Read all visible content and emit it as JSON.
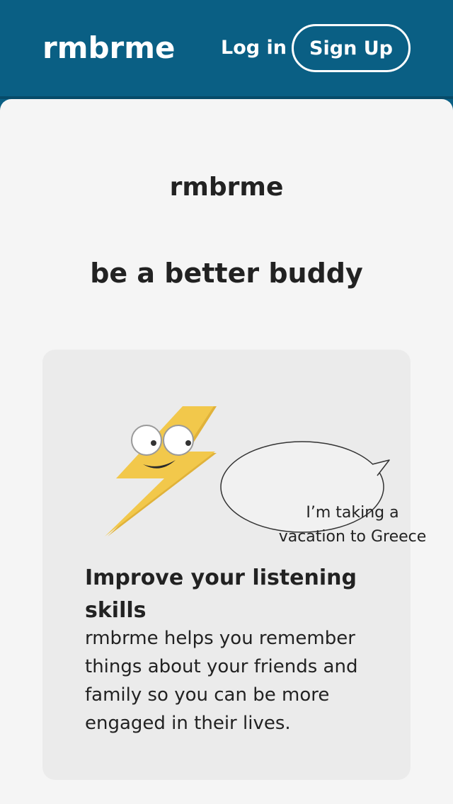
{
  "header": {
    "brand": "rmbrme",
    "login_label": "Log in",
    "signup_label": "Sign Up"
  },
  "hero": {
    "title": "rmbrme",
    "tagline": "be a better buddy"
  },
  "feature": {
    "illustration_icon": "lightning-mascot-icon",
    "speech_bubble_text": "I’m taking a vacation to Greece",
    "title": "Improve your listening skills",
    "body": "rmbrme helps you remember things about your friends and family so you can be more engaged in their lives."
  },
  "colors": {
    "header_bg": "#0a5f84",
    "page_bg": "#f5f5f5",
    "card_bg": "#ebebeb",
    "bolt_yellow": "#f2c84b",
    "bolt_shadow": "#e0b23a"
  }
}
